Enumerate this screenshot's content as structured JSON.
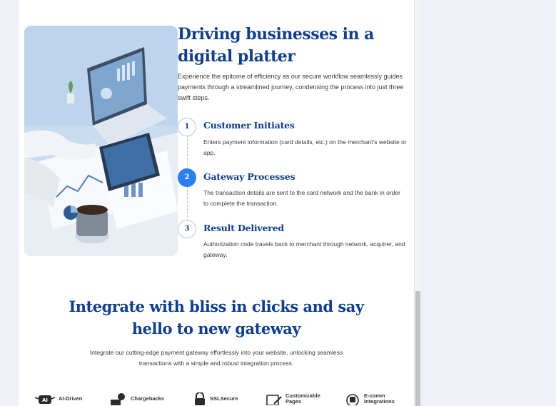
{
  "hero": {
    "title": "Driving businesses in a digital platter",
    "intro": "Experience the epitome of efficiency as our secure workflow seamlessly guides payments through a streamlined journey, condensing the process into just three swift steps."
  },
  "steps": [
    {
      "num": "1",
      "title": "Customer Initiates",
      "desc": "Enters payment information (card details, etc.) on the merchant's website or app.",
      "active": false
    },
    {
      "num": "2",
      "title": "Gateway Processes",
      "desc": "The transaction details are sent to the card network and the bank in order to complete the transaction.",
      "active": true
    },
    {
      "num": "3",
      "title": "Result Delivered",
      "desc": "Authorization code travels back to merchant through network, acquirer, and gateway.",
      "active": false
    }
  ],
  "integrate": {
    "title": "Integrate with bliss in clicks and say hello to new gateway",
    "subtitle": "Integrate our cutting-edge payment gateway effortlessly into your website, unlocking seamless transactions with a simple and robust integration process."
  },
  "features": [
    {
      "label": "AI-Driven",
      "icon": "ai-robot-icon"
    },
    {
      "label": "Chargebacks",
      "icon": "chargeback-icon"
    },
    {
      "label": "SSLSecure",
      "icon": "lock-icon"
    },
    {
      "label": "Customizable Pages",
      "icon": "customize-page-icon"
    },
    {
      "label": "E-comm Integrations",
      "icon": "ecomm-icon"
    }
  ],
  "colors": {
    "heading": "#0f3f8c",
    "accent": "#2a7ff3",
    "body_text": "#3a3a3a"
  }
}
